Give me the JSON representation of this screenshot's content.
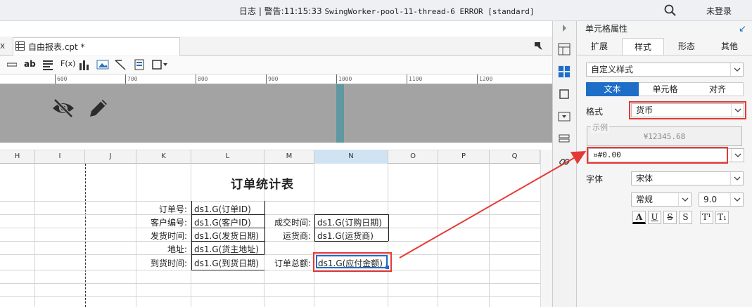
{
  "topbar": {
    "log_label": "日志 | 警告:11:15:33",
    "log_message": "SwingWorker-pool-11-thread-6 ERROR [standard]",
    "login_label": "未登录"
  },
  "tab": {
    "close": "x",
    "title": "自由报表.cpt *"
  },
  "toolbar": {
    "ab": "ab",
    "fx": "F(x)"
  },
  "ruler": [
    "600",
    "700",
    "800",
    "900",
    "1000",
    "1100",
    "1200"
  ],
  "grid": {
    "columns": [
      "H",
      "I",
      "J",
      "K",
      "L",
      "M",
      "N",
      "O",
      "P",
      "Q"
    ],
    "selected_column": "N"
  },
  "report": {
    "title": "订单统计表",
    "labels": {
      "order_id": "订单号:",
      "customer": "客户编号:",
      "ship_date": "发货时间:",
      "address": "地址:",
      "arrive": "到货时间:",
      "deal_time": "成交时间:",
      "shipper": "运货商:",
      "total": "订单总额:"
    },
    "values": {
      "order_id": "ds1.G(订单ID)",
      "customer": "ds1.G(客户ID)",
      "ship_date": "ds1.G(发货日期)",
      "address": "ds1.G(货主地址)",
      "arrive": "ds1.G(到货日期)",
      "deal_time": "ds1.G(订购日期)",
      "shipper": "ds1.G(运货商)",
      "total": "ds1.G(应付金额)"
    }
  },
  "panel": {
    "title": "单元格属性",
    "tabs": [
      "扩展",
      "样式",
      "形态",
      "其他"
    ],
    "active_tab": "样式",
    "style_select": "自定义样式",
    "segments": [
      "文本",
      "单元格",
      "对齐"
    ],
    "active_segment": "文本",
    "format_label": "格式",
    "format_value": "货币",
    "sample_label": "示例",
    "sample_value": "¥12345.68",
    "pattern_value": "¤#0.00",
    "font_label": "字体",
    "font_family": "宋体",
    "font_style": "常规",
    "font_size": "9.0",
    "buttons": [
      "A",
      "U",
      "S",
      "S",
      "T¹",
      "T₁"
    ]
  },
  "colors": {
    "accent": "#1e6ec8",
    "highlight": "#e53935",
    "teal": "#5f98a0"
  }
}
